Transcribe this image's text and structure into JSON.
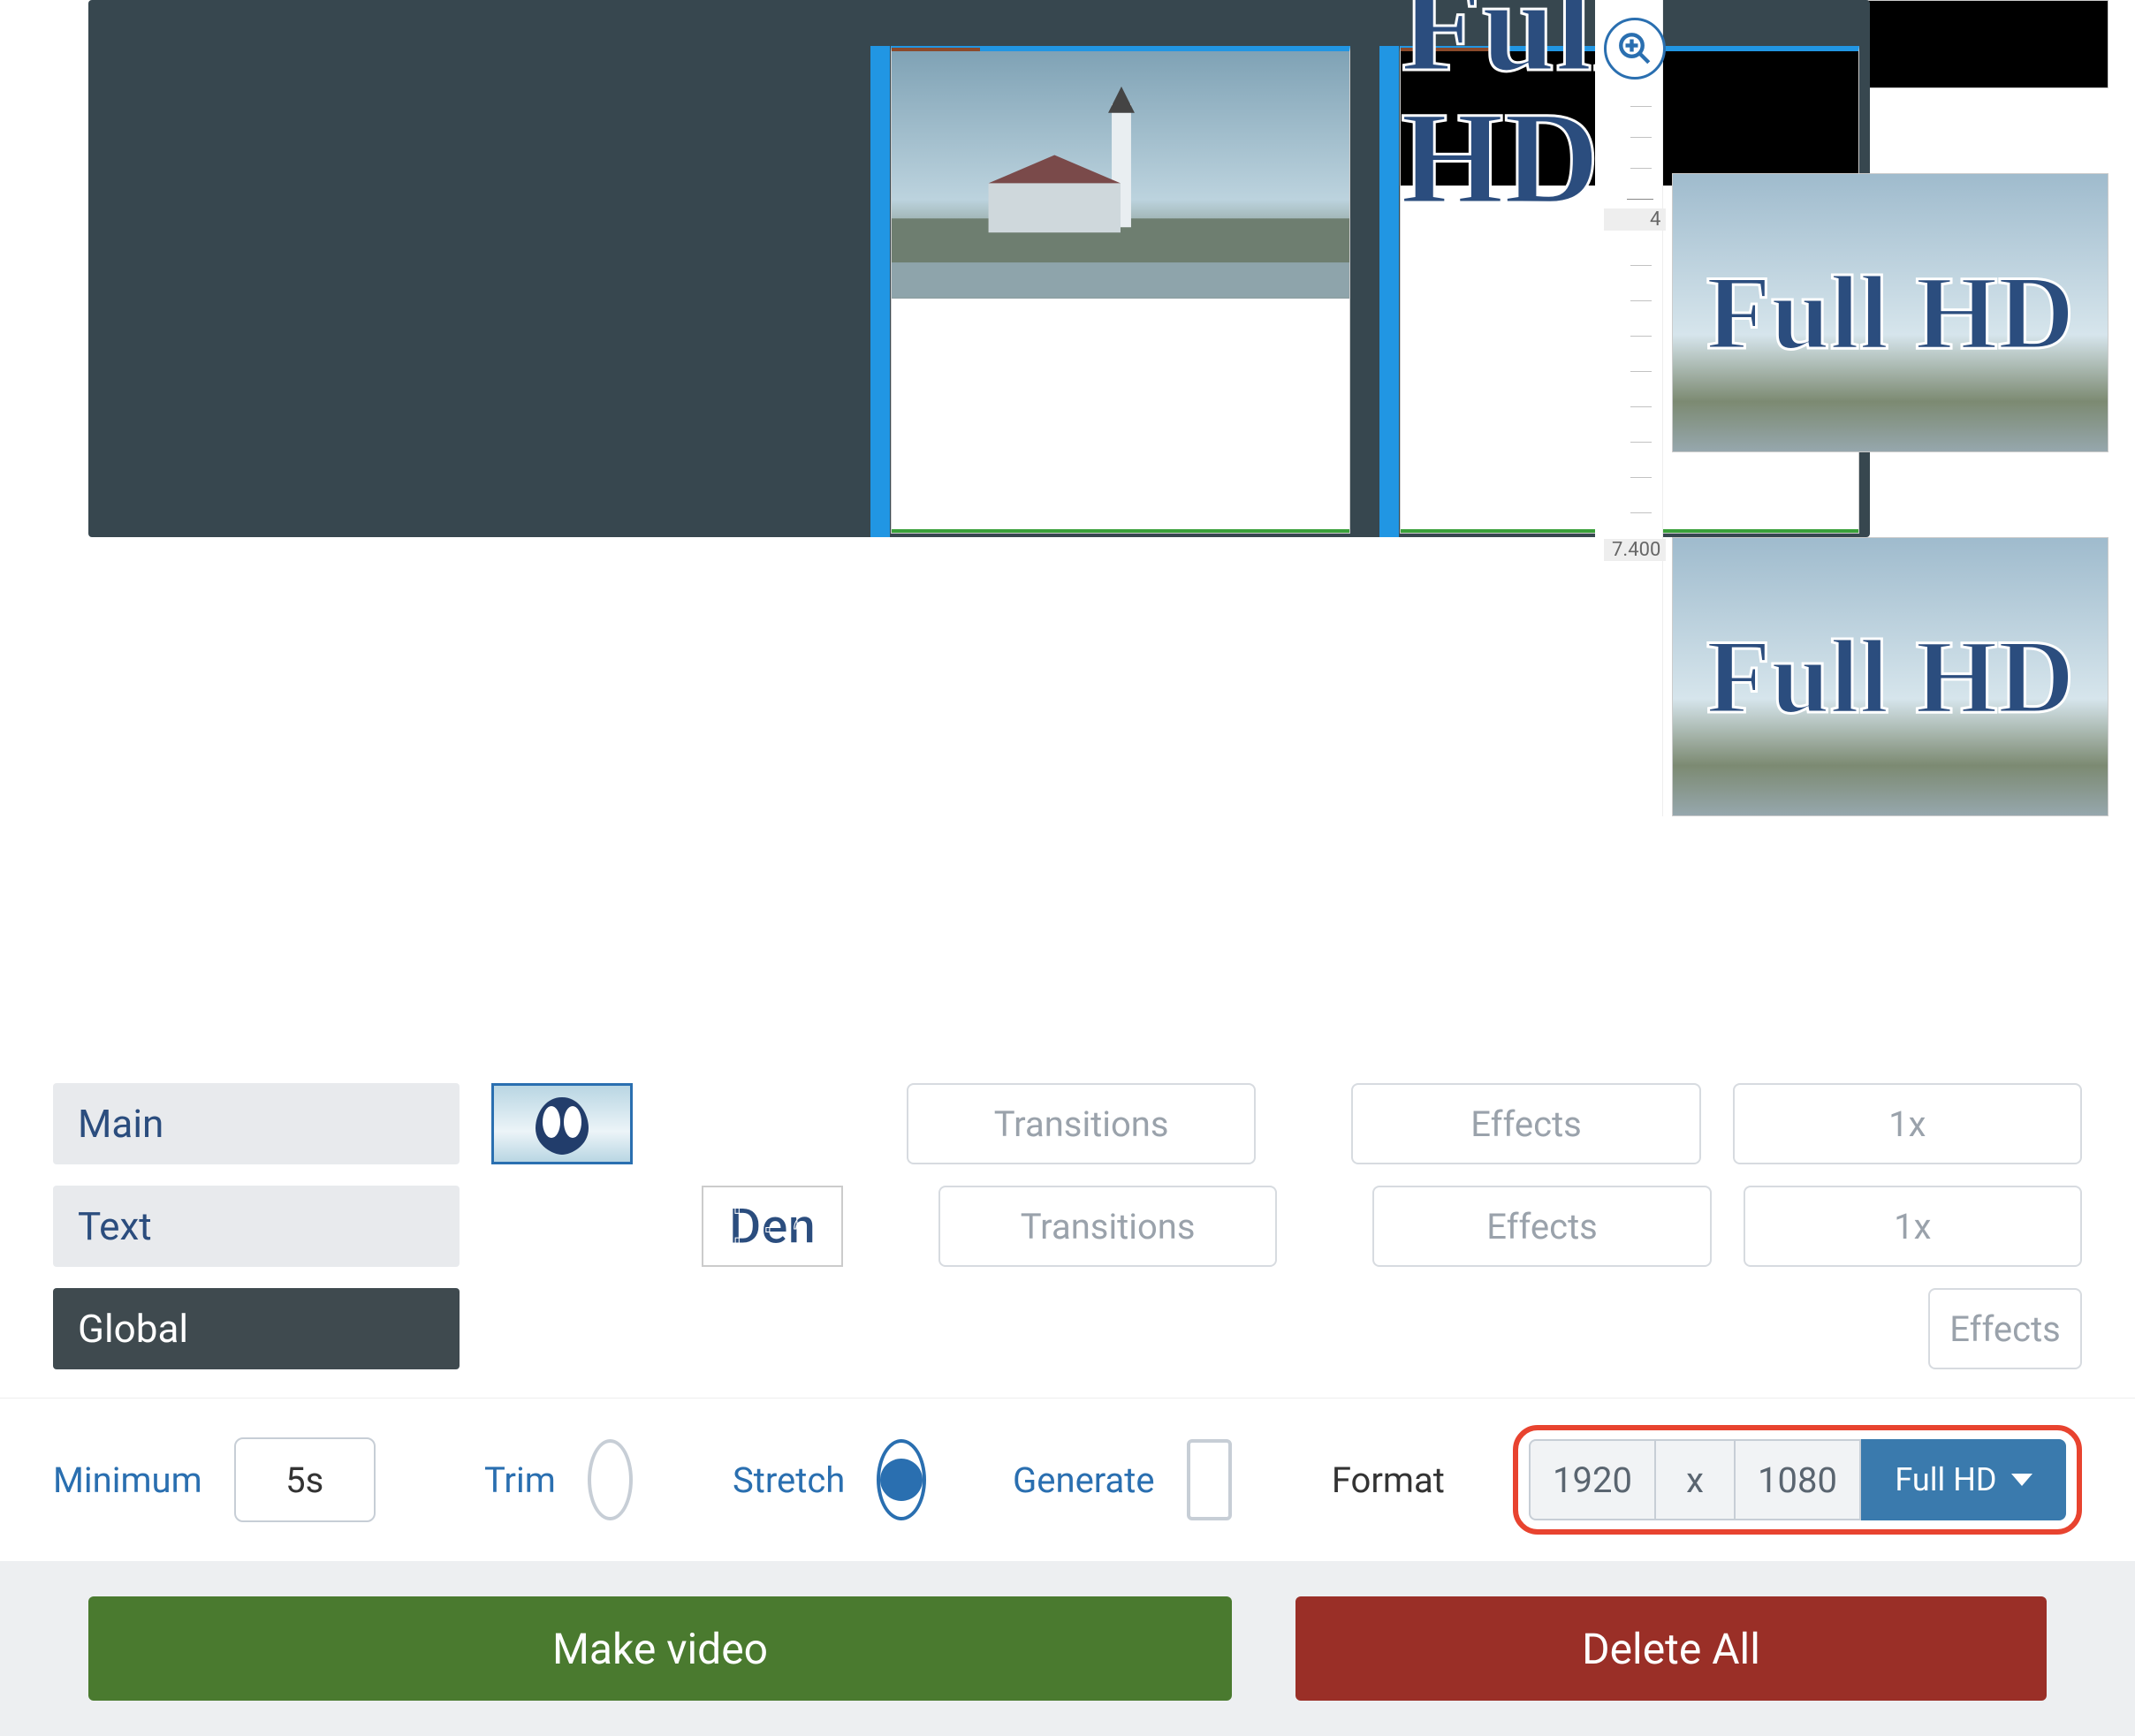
{
  "timeline": {
    "time_labels": [
      "4",
      "7.400"
    ]
  },
  "clip_label": "Full HD",
  "tracks": {
    "main": "Main",
    "text": "Text",
    "global": "Global",
    "text_thumb": "Den",
    "transitions_label": "Transitions",
    "effects_label": "Effects",
    "speed_label": "1x"
  },
  "controls": {
    "minimum_label": "Minimum",
    "minimum_value": "5s",
    "trim_label": "Trim",
    "stretch_label": "Stretch",
    "generate_label": "Generate",
    "format_label": "Format",
    "width": "1920",
    "height": "1080",
    "preset": "Full HD"
  },
  "footer": {
    "make": "Make video",
    "delete": "Delete All"
  }
}
